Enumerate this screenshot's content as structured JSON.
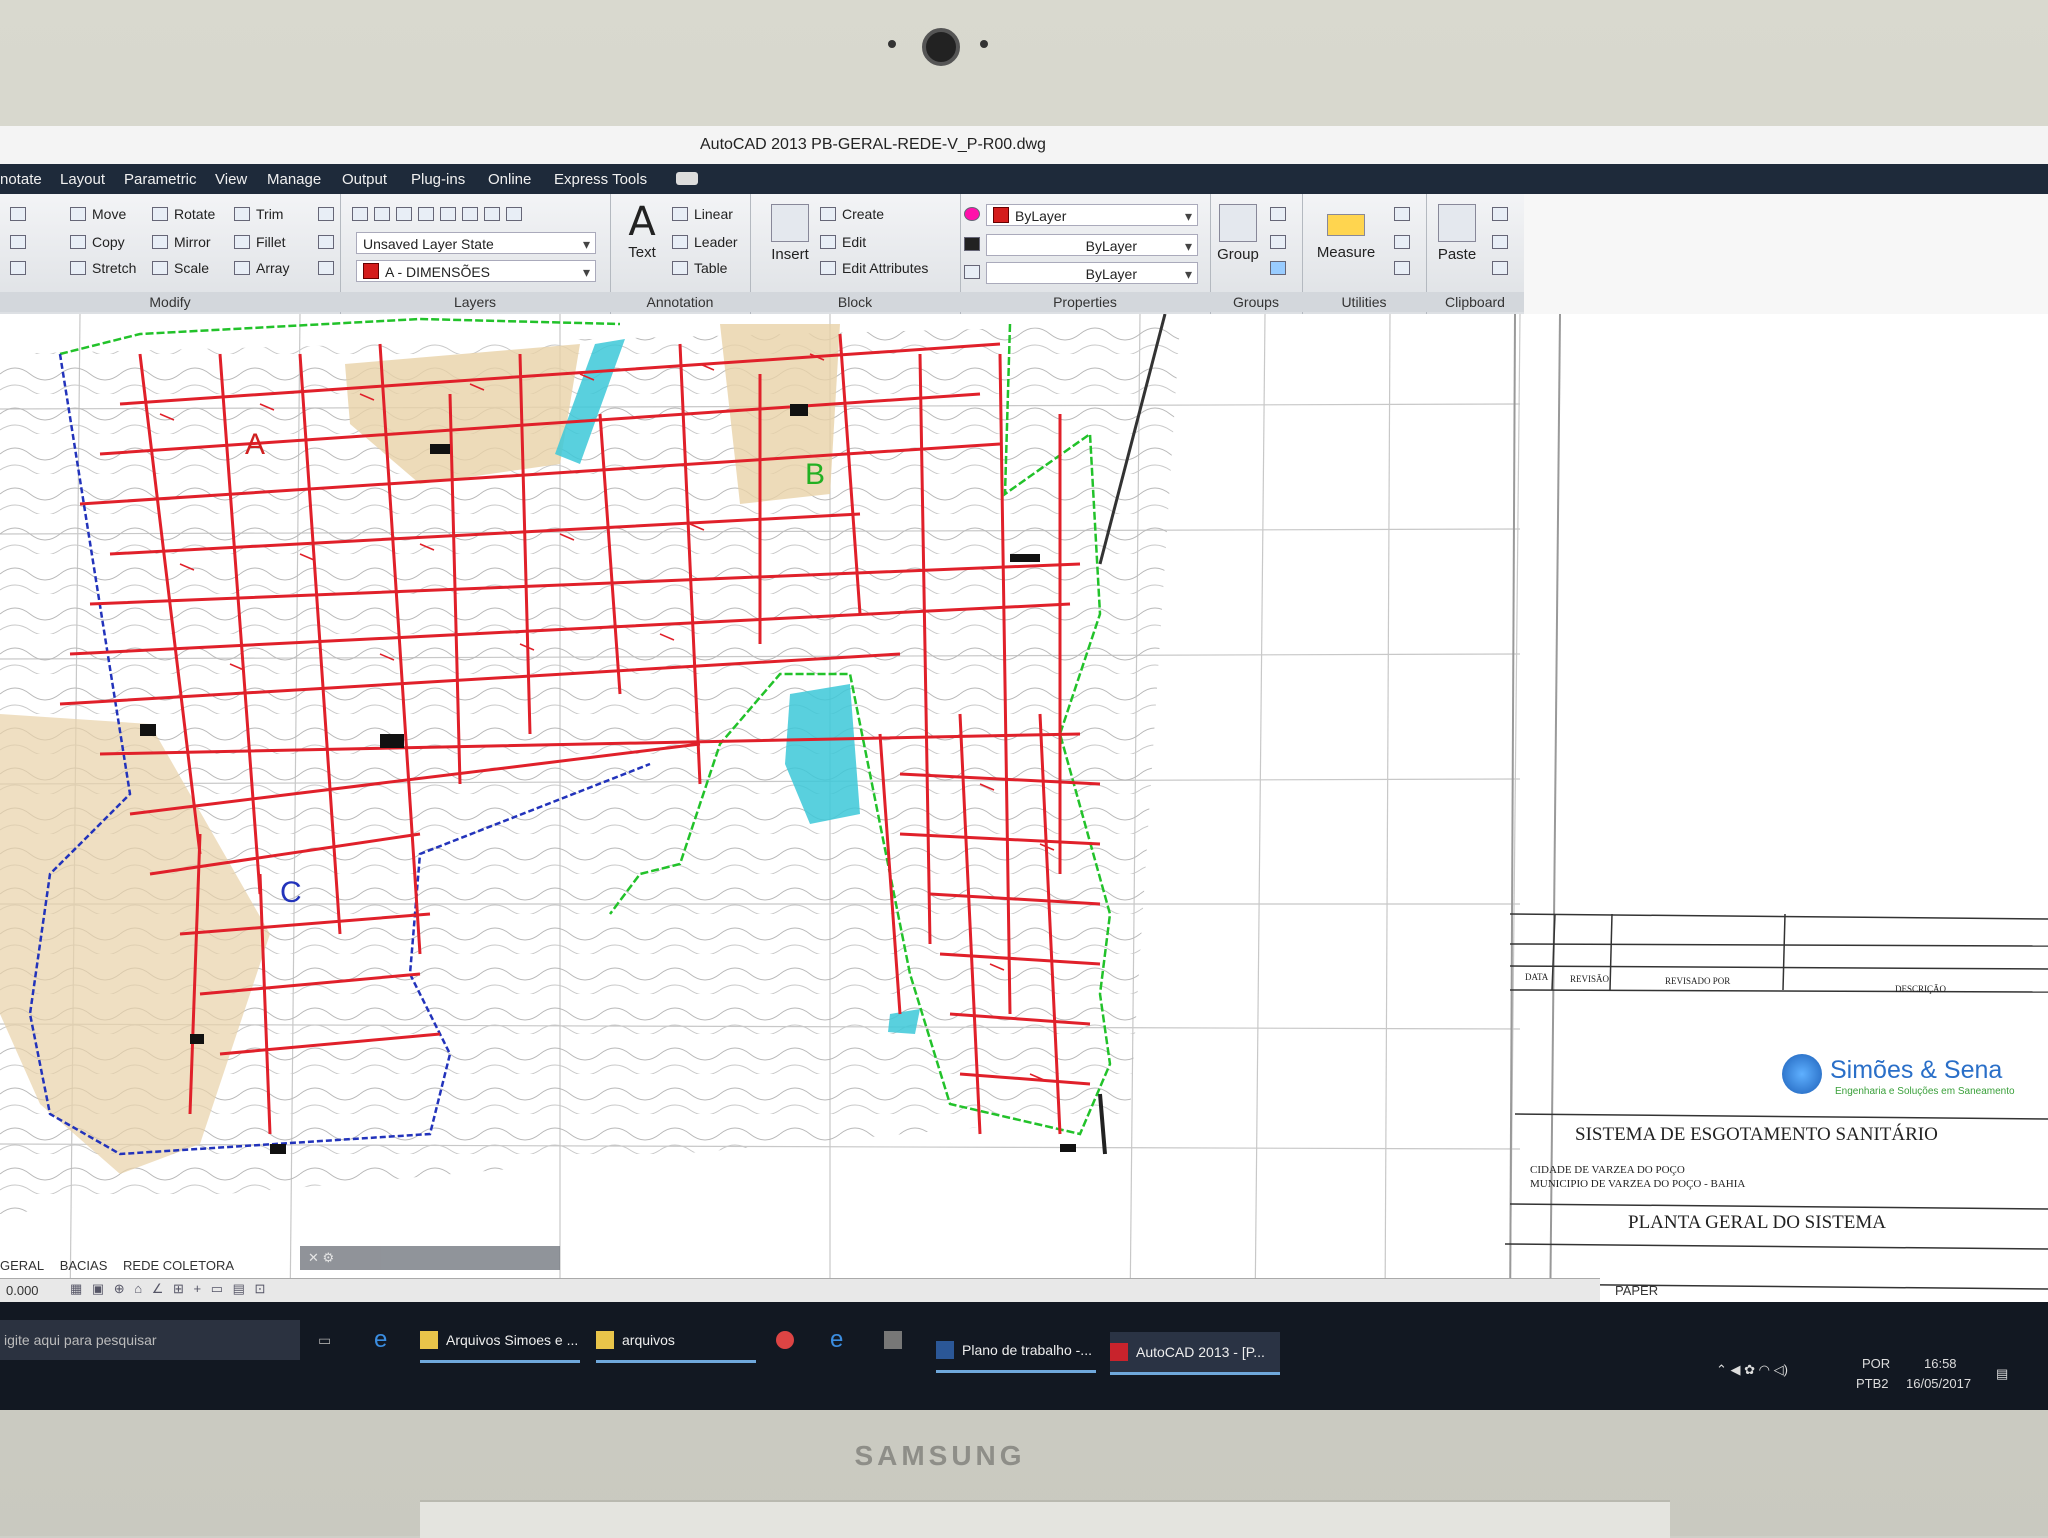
{
  "window": {
    "title": "AutoCAD 2013   PB-GERAL-REDE-V_P-R00.dwg"
  },
  "menu": [
    "notate",
    "Layout",
    "Parametric",
    "View",
    "Manage",
    "Output",
    "Plug-ins",
    "Online",
    "Express Tools"
  ],
  "ribbon": {
    "modify": {
      "label": "Modify",
      "move": "Move",
      "rotate": "Rotate",
      "trim": "Trim",
      "copy": "Copy",
      "mirror": "Mirror",
      "fillet": "Fillet",
      "stretch": "Stretch",
      "scale": "Scale",
      "array": "Array"
    },
    "layers": {
      "label": "Layers",
      "state": "Unsaved Layer State",
      "current": "A - DIMENSÕES"
    },
    "annotation": {
      "label": "Annotation",
      "text": "Text",
      "linear": "Linear",
      "leader": "Leader",
      "table": "Table"
    },
    "block": {
      "label": "Block",
      "insert": "Insert",
      "create": "Create",
      "edit": "Edit",
      "edit_attributes": "Edit Attributes"
    },
    "properties": {
      "label": "Properties",
      "color": "ByLayer",
      "lineweight": "ByLayer",
      "linetype": "ByLayer"
    },
    "groups": {
      "label": "Groups",
      "group": "Group"
    },
    "utilities": {
      "label": "Utilities",
      "measure": "Measure"
    },
    "clipboard": {
      "label": "Clipboard",
      "paste": "Paste"
    }
  },
  "drawing": {
    "zone_labels": [
      "A",
      "B",
      "C"
    ],
    "title_block": {
      "revision_headers": [
        "DATA",
        "REVISÃO",
        "REVISADO POR",
        "DESCRIÇÃO"
      ],
      "company": "Simões & Sena",
      "company_tagline": "Engenharia e Soluções em Saneamento",
      "project": "SISTEMA DE ESGOTAMENTO SANITÁRIO",
      "location_1": "CIDADE DE VARZEA DO POÇO",
      "location_2": "MUNICIPIO DE VARZEA DO POÇO - BAHIA",
      "sheet_title": "PLANTA GERAL DO SISTEMA"
    }
  },
  "layout_tabs": [
    "GERAL",
    "BACIAS",
    "REDE COLETORA"
  ],
  "status": {
    "coord": "0.000",
    "paper": "PAPER"
  },
  "taskbar": {
    "search_placeholder": "igite aqui para pesquisar",
    "apps": [
      "Arquivos Simoes e ...",
      "arquivos",
      "Plano de trabalho -...",
      "AutoCAD 2013 - [P..."
    ],
    "language": "POR",
    "keyboard": "PTB2",
    "time": "16:58",
    "date": "16/05/2017"
  },
  "monitor_brand": "SAMSUNG",
  "colors": {
    "network": "#e0202a",
    "boundary_green": "#22c22a",
    "boundary_blue": "#2233bb",
    "pond": "#3cc8d8",
    "parcel": "#e8d2a8"
  }
}
